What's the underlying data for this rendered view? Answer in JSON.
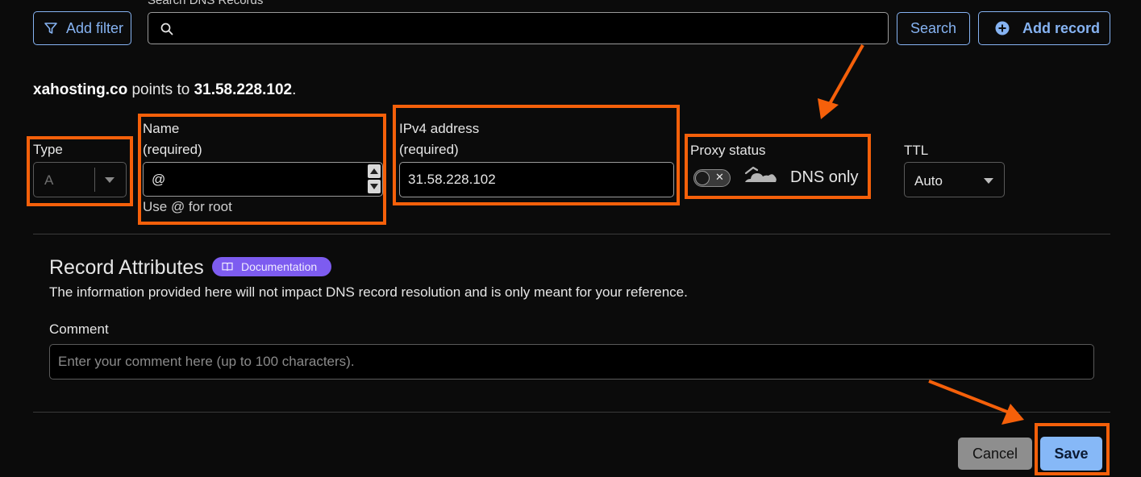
{
  "toolbar": {
    "add_filter_label": "Add filter",
    "search_label": "Search DNS Records",
    "search_value": "",
    "search_button_label": "Search",
    "add_record_label": "Add record"
  },
  "points_to": {
    "domain": "xahosting.co",
    "middle": " points to ",
    "ip": "31.58.228.102",
    "end": "."
  },
  "form": {
    "type": {
      "label": "Type",
      "value": "A"
    },
    "name": {
      "label": "Name",
      "required": "(required)",
      "value": "@",
      "hint": "Use @ for root"
    },
    "ipv4": {
      "label": "IPv4 address",
      "required": "(required)",
      "value": "31.58.228.102"
    },
    "proxy": {
      "label": "Proxy status",
      "value": "DNS only",
      "enabled": false
    },
    "ttl": {
      "label": "TTL",
      "value": "Auto"
    }
  },
  "attributes": {
    "title": "Record Attributes",
    "doc_badge": "Documentation",
    "description": "The information provided here will not impact DNS record resolution and is only meant for your reference.",
    "comment_label": "Comment",
    "comment_placeholder": "Enter your comment here (up to 100 characters)."
  },
  "actions": {
    "cancel_label": "Cancel",
    "save_label": "Save"
  },
  "colors": {
    "accent": "#86b3f2",
    "highlight": "#f5600a",
    "badge": "#7d5cf0",
    "background": "#0b0b0b"
  },
  "icons": {
    "filter": "filter-icon",
    "search": "search-icon",
    "add": "plus-circle-icon",
    "cloud": "cloud-icon",
    "book": "book-icon"
  }
}
